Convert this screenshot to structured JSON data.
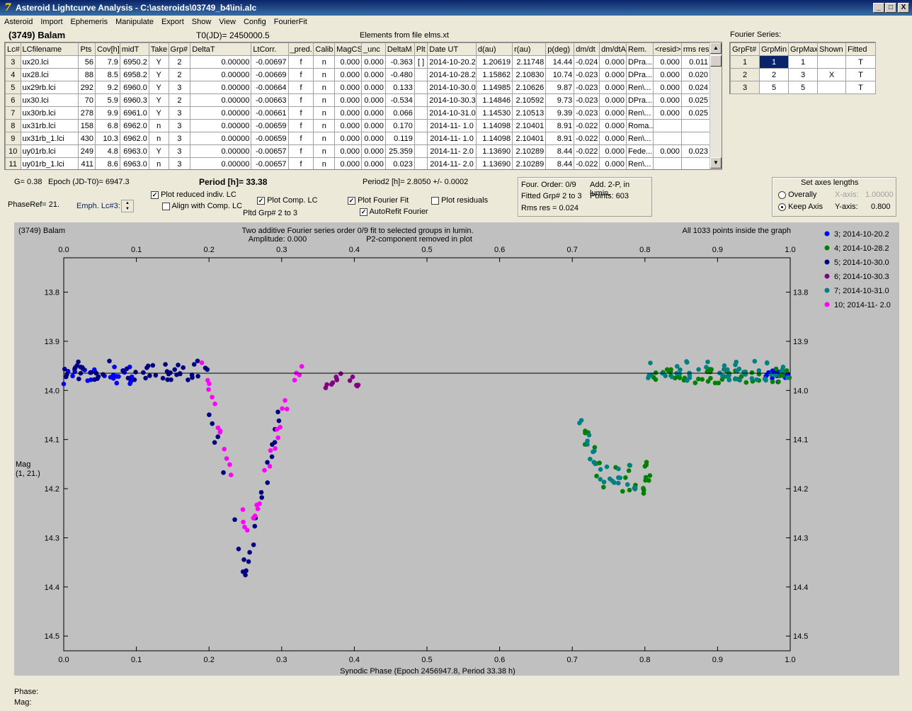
{
  "window": {
    "title": "Asteroid Lightcurve Analysis - C:\\asteroids\\03749_b4\\ini.alc",
    "minimize": "_",
    "maximize": "□",
    "close": "X"
  },
  "menu": [
    "Asteroid",
    "Import",
    "Ephemeris",
    "Manipulate",
    "Export",
    "Show",
    "View",
    "Config",
    "FourierFit"
  ],
  "header": {
    "object": "(3749) Balam",
    "t0": "T0(JD)= 2450000.5",
    "elements": "Elements from file elms.xt"
  },
  "lc_table": {
    "columns": [
      "Lc#",
      "LCfilename",
      "Pts",
      "Cov[h]",
      "midT",
      "Take",
      "Grp#",
      "DeltaT",
      "LtCorr.",
      "_pred.",
      "Calib",
      "MagCS",
      "_unc",
      "DeltaM",
      "Plt",
      "Date UT",
      "d(au)",
      "r(au)",
      "p(deg)",
      "dm/dt",
      "dm/dtA",
      "Rem.",
      "<resid>",
      "rms res"
    ],
    "rows": [
      [
        "3",
        "ux20.lci",
        "56",
        "7.9",
        "6950.2",
        "Y",
        "2",
        "0.00000",
        "-0.00697",
        "f",
        "n",
        "0.000",
        "0.000",
        "-0.363",
        "[ ]",
        "2014-10-20.2",
        "1.20619",
        "2.11748",
        "14.44",
        "-0.024",
        "0.000",
        "DPra...",
        "0.000",
        "0.011"
      ],
      [
        "4",
        "ux28.lci",
        "88",
        "8.5",
        "6958.2",
        "Y",
        "2",
        "0.00000",
        "-0.00669",
        "f",
        "n",
        "0.000",
        "0.000",
        "-0.480",
        "",
        "2014-10-28.2",
        "1.15862",
        "2.10830",
        "10.74",
        "-0.023",
        "0.000",
        "DPra...",
        "0.000",
        "0.020"
      ],
      [
        "5",
        "ux29rb.lci",
        "292",
        "9.2",
        "6960.0",
        "Y",
        "3",
        "0.00000",
        "-0.00664",
        "f",
        "n",
        "0.000",
        "0.000",
        "0.133",
        "",
        "2014-10-30.0",
        "1.14985",
        "2.10626",
        "9.87",
        "-0.023",
        "0.000",
        "Ren\\...",
        "0.000",
        "0.024"
      ],
      [
        "6",
        "ux30.lci",
        "70",
        "5.9",
        "6960.3",
        "Y",
        "2",
        "0.00000",
        "-0.00663",
        "f",
        "n",
        "0.000",
        "0.000",
        "-0.534",
        "",
        "2014-10-30.3",
        "1.14846",
        "2.10592",
        "9.73",
        "-0.023",
        "0.000",
        "DPra...",
        "0.000",
        "0.025"
      ],
      [
        "7",
        "ux30rb.lci",
        "278",
        "9.9",
        "6961.0",
        "Y",
        "3",
        "0.00000",
        "-0.00661",
        "f",
        "n",
        "0.000",
        "0.000",
        "0.066",
        "",
        "2014-10-31.0",
        "1.14530",
        "2.10513",
        "9.39",
        "-0.023",
        "0.000",
        "Ren\\...",
        "0.000",
        "0.025"
      ],
      [
        "8",
        "ux31rb.lci",
        "158",
        "6.8",
        "6962.0",
        "n",
        "3",
        "0.00000",
        "-0.00659",
        "f",
        "n",
        "0.000",
        "0.000",
        "0.170",
        "",
        "2014-11- 1.0",
        "1.14098",
        "2.10401",
        "8.91",
        "-0.022",
        "0.000",
        "Roma...",
        "",
        ""
      ],
      [
        "9",
        "ux31rb_1.lci",
        "430",
        "10.3",
        "6962.0",
        "n",
        "3",
        "0.00000",
        "-0.00659",
        "f",
        "n",
        "0.000",
        "0.000",
        "0.119",
        "",
        "2014-11- 1.0",
        "1.14098",
        "2.10401",
        "8.91",
        "-0.022",
        "0.000",
        "Ren\\...",
        "",
        ""
      ],
      [
        "10",
        "uy01rb.lci",
        "249",
        "4.8",
        "6963.0",
        "Y",
        "3",
        "0.00000",
        "-0.00657",
        "f",
        "n",
        "0.000",
        "0.000",
        "25.359",
        "",
        "2014-11- 2.0",
        "1.13690",
        "2.10289",
        "8.44",
        "-0.022",
        "0.000",
        "Fede...",
        "0.000",
        "0.023"
      ],
      [
        "11",
        "uy01rb_1.lci",
        "411",
        "8.6",
        "6963.0",
        "n",
        "3",
        "0.00000",
        "-0.00657",
        "f",
        "n",
        "0.000",
        "0.000",
        "0.023",
        "",
        "2014-11- 2.0",
        "1.13690",
        "2.10289",
        "8.44",
        "-0.022",
        "0.000",
        "Ren\\...",
        "",
        ""
      ]
    ]
  },
  "fourier_series": {
    "label": "Fourier Series:",
    "columns": [
      "GrpFt#",
      "GrpMin",
      "GrpMax",
      "Shown",
      "Fitted"
    ],
    "rows": [
      [
        "1",
        "1",
        "1",
        "",
        "T"
      ],
      [
        "2",
        "2",
        "3",
        "X",
        "T"
      ],
      [
        "3",
        "5",
        "5",
        "",
        "T"
      ]
    ]
  },
  "controls": {
    "g": "G= 0.38",
    "epoch": "Epoch (JD-T0)= 6947.3",
    "period": "Period [h]= 33.38",
    "period2": "Period2 [h]= 2.8050 +/- 0.0002",
    "phaseref": "PhaseRef= 21.",
    "emph": "Emph. Lc#3:",
    "plot_reduced": "Plot reduced indiv. LC",
    "align": "Align with Comp. LC",
    "plot_comp": "Plot Comp. LC",
    "pltd_grp": "Pltd Grp#  2  to   3",
    "plot_fourier": "Plot Fourier Fit",
    "autorefit": "AutoRefit Fourier",
    "plot_residuals": "Plot residuals",
    "four_order": "Four. Order:  0/9",
    "add2p": "Add. 2-P, in lumin.",
    "fitted_grp": "Fitted Grp# 2 to 3",
    "points": "Points: 603",
    "rms": "Rms res     = 0.024",
    "axes_title": "Set axes lengths",
    "overally": "Overally",
    "keep_axis": "Keep Axis",
    "xaxis_label": "X-axis:",
    "xaxis_val": "1.00000",
    "yaxis_label": "Y-axis:",
    "yaxis_val": "0.800"
  },
  "chart_data": {
    "type": "scatter",
    "title_left": "(3749) Balam",
    "title": "Two additive Fourier series order 0/9 fit to selected groups in lumin.",
    "subtitle_amp": "Amplitude: 0.000",
    "subtitle_p2": "P2-component removed in plot",
    "title_right": "All 1033 points inside the graph",
    "xlabel": "Synodic Phase (Epoch 2456947.8, Period 33.38 h)",
    "ylabel": "Mag",
    "ylabel2": "(1, 21.)",
    "xlim": [
      0.0,
      1.0
    ],
    "ylim": [
      13.73,
      14.53
    ],
    "y_inverted": true,
    "xticks": [
      "0.0",
      "0.1",
      "0.2",
      "0.3",
      "0.4",
      "0.5",
      "0.6",
      "0.7",
      "0.8",
      "0.9",
      "1.0"
    ],
    "yticks": [
      "13.8",
      "13.9",
      "14.0",
      "14.1",
      "14.2",
      "14.3",
      "14.4",
      "14.5"
    ],
    "fit_line_mag": 13.965,
    "legend_position": "right",
    "series": [
      {
        "name": "3; 2014-10-20.2",
        "color": "#0000ff",
        "ranges": [
          [
            0.0,
            0.1,
            13.97,
            0.04
          ],
          [
            0.95,
            1.0,
            13.97,
            0.03
          ]
        ]
      },
      {
        "name": "4; 2014-10-28.2",
        "color": "#008000",
        "ranges": [
          [
            0.71,
            0.81,
            14.17,
            0.05
          ],
          [
            0.81,
            1.0,
            13.97,
            0.03
          ]
        ]
      },
      {
        "name": "5; 2014-10-30.0",
        "color": "#000080",
        "ranges": [
          [
            0.0,
            0.2,
            13.96,
            0.04
          ],
          [
            0.2,
            0.3,
            14.2,
            0.2
          ]
        ]
      },
      {
        "name": "6; 2014-10-30.3",
        "color": "#800080",
        "ranges": [
          [
            0.36,
            0.41,
            13.98,
            0.03
          ]
        ]
      },
      {
        "name": "7; 2014-10-31.0",
        "color": "#008080",
        "ranges": [
          [
            0.7,
            0.8,
            14.12,
            0.08
          ],
          [
            0.8,
            1.0,
            13.96,
            0.04
          ]
        ]
      },
      {
        "name": "10; 2014-11- 2.0",
        "color": "#ff00ff",
        "ranges": [
          [
            0.19,
            0.33,
            14.12,
            0.18
          ]
        ]
      }
    ]
  },
  "status": {
    "phase": "Phase:",
    "mag": "Mag:"
  }
}
